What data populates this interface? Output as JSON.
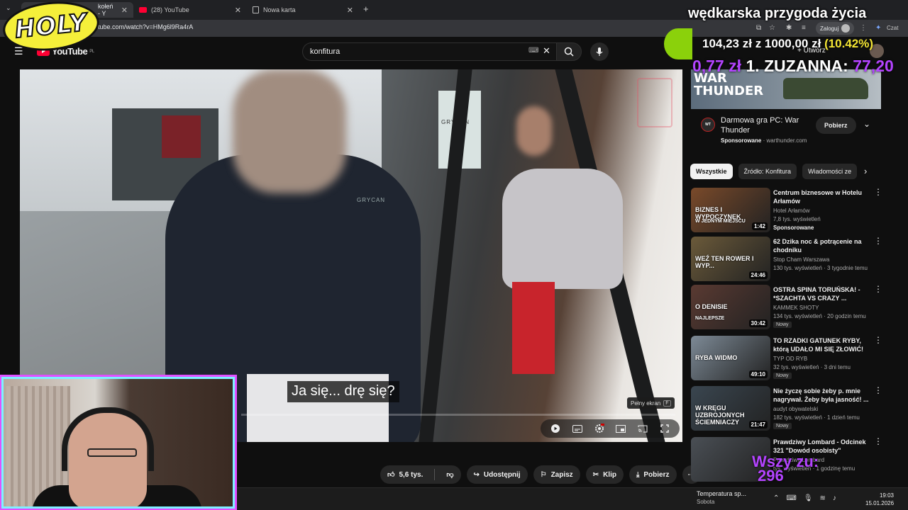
{
  "browser": {
    "tabs": [
      {
        "label": "kołeń - Y",
        "active": true
      },
      {
        "label": "(28) YouTube",
        "active": false
      },
      {
        "label": "Nowa karta",
        "active": false
      }
    ],
    "new_tab_symbol": "+",
    "url": "tube.com/watch?v=HMg6l9Ra4rA",
    "login_label": "Zaloguj",
    "chat_label": "Czat"
  },
  "youtube": {
    "logo_text": "YouTube",
    "logo_region": "PL",
    "search_value": "konfitura",
    "create_label": "Utwórz"
  },
  "video": {
    "subtitle": "Ja się... drę się?",
    "fullscreen_tip": "Pełny ekran",
    "fullscreen_key": "F",
    "storefront_text": "GRYCAN",
    "shirt_text": "GRYCAN"
  },
  "actions": {
    "likes": "5,6 tys.",
    "share": "Udostępnij",
    "save": "Zapisz",
    "clip": "Klip",
    "download": "Pobierz"
  },
  "ad": {
    "banner_line1": "WAR",
    "banner_line2": "THUNDER",
    "icon_text": "WAR THUNDER",
    "title": "Darmowa gra PC: War Thunder",
    "sponsored": "Sponsorowane",
    "domain": "warthunder.com",
    "button": "Pobierz"
  },
  "chips": [
    "Wszystkie",
    "Źródło: Konfitura",
    "Wiadomości ze"
  ],
  "recommendations": [
    {
      "title": "Centrum biznesowe w Hotelu Arłamów",
      "channel": "Hotel Arłamów",
      "meta": "7,8 tys. wyświetleń",
      "badge": "Sponsorowane",
      "duration": "1:42",
      "thumb_text": "BIZNES I WYPOCZYNEK",
      "thumb_sub": "W JEDNYM MIEJSCU",
      "color": "#7a4a2a"
    },
    {
      "title": "62 Dzika noc & potrącenie na chodniku",
      "channel": "Stop Cham Warszawa",
      "meta": "130 tys. wyświetleń · 3 tygodnie temu",
      "badge": "",
      "duration": "24:46",
      "thumb_text": "WEŹ TEN ROWER I WYP...",
      "thumb_sub": "",
      "color": "#6b5a3a"
    },
    {
      "title": "OSTRA SPINA TORUŃSKA! - *SZACHTA VS CRAZY ...",
      "channel": "KAMMEK SHOTY",
      "meta": "134 tys. wyświetleń · 20 godzin temu",
      "badge": "Nowy",
      "duration": "30:42",
      "thumb_text": "O DENISIE",
      "thumb_sub": "NAJLEPSZE",
      "color": "#5a3a32"
    },
    {
      "title": "TO RZADKI GATUNEK RYBY, którą UDAŁO MI SIĘ ZŁOWIĆ!",
      "channel": "TYP OD RYB",
      "meta": "32 tys. wyświetleń · 3 dni temu",
      "badge": "Nowy",
      "duration": "49:10",
      "thumb_text": "RYBA WIDMO",
      "thumb_sub": "",
      "color": "#7d8a96"
    },
    {
      "title": "Nie życzę sobie żeby p. mnie nagrywał. Żeby była jasność! ...",
      "channel": "audyt obywatelski",
      "meta": "182 tys. wyświetleń · 1 dzień temu",
      "badge": "Nowy",
      "duration": "21:47",
      "thumb_text": "W KRĘGU UZBROJONYCH ŚCIEMNIACZY",
      "thumb_sub": "",
      "color": "#3a4650"
    },
    {
      "title": "Prawdziwy Lombard - Odcinek 321 \"Dowód osobisty\"",
      "channel": "Prawdziwy Lombard",
      "meta": "tys. wyświetleń · 1 godzinę temu",
      "badge": "",
      "duration": "",
      "thumb_text": "",
      "thumb_sub": "",
      "color": "#4a4f55"
    }
  ],
  "taskbar": {
    "weather": "Temperatura sp...",
    "weather_sub": "Sobota",
    "time": "19:03",
    "date": "15.01.2026"
  },
  "stream": {
    "logo": "HOLY",
    "title": "wędkarska przygoda życia",
    "donation_current": "104,23 zł",
    "donation_sep": "z",
    "donation_goal": "1000,00 zł",
    "donation_pct": "(10.42%)",
    "top_donor_left": "0,77 zł",
    "top_donor_name": "1. ZUZANNA:",
    "top_donor_right": "77,20",
    "bottom_overlay_1": "Wszy zu:",
    "bottom_overlay_2": "296"
  }
}
